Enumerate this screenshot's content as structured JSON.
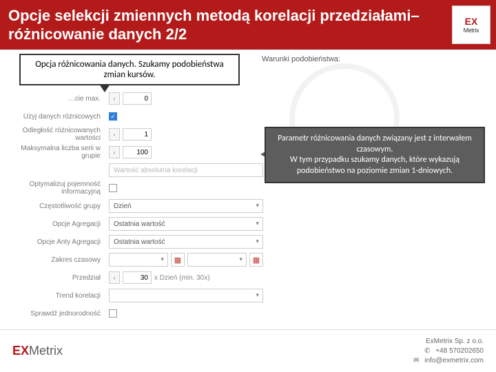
{
  "header": {
    "title": "Opcje selekcji zmiennych metodą korelacji przedziałami– różnicowanie danych 2/2"
  },
  "logo": {
    "ex": "EX",
    "metrix": "Metrix"
  },
  "leadLabel": "Warunki podobieństwa:",
  "callout1": "Opcja różnicowania danych. Szukamy podobieństwa zmian kursów.",
  "callout2": "Parametr różnicowania danych związany jest z interwałem czasowym.\nW tym przypadku szukamy danych, które wykazują podobieństwo na poziomie zmian 1-dniowych.",
  "form": {
    "rows": [
      {
        "label": "…cie max.",
        "stepperValue": "0"
      },
      {
        "label": "Użyj danych różnicowych",
        "check": true
      },
      {
        "label": "Odległość różnicowanych wartości",
        "stepperValue": "1"
      },
      {
        "label": "Maksymalna liczba serii w grupie",
        "stepperValue": "100"
      },
      {
        "label": "",
        "placeholder": "Wartość absolutna korelacji"
      },
      {
        "label": "Optymalizuj pojemność informacyjną",
        "check": false
      },
      {
        "label": "Częstotliwość grupy",
        "select": "Dzień"
      },
      {
        "label": "Opcje Agregacji",
        "select": "Ostatnia wartość"
      },
      {
        "label": "Opcje Anty Agregacji",
        "select": "Ostatnia wartość"
      },
      {
        "label": "Zakres czasowy",
        "date": true
      },
      {
        "label": "Przedział",
        "stepperValue": "30",
        "hint": "x Dzień (min. 30x)"
      },
      {
        "label": "Trend korelacji",
        "select": ""
      },
      {
        "label": "Sprawdź jednorodność",
        "check": false
      }
    ]
  },
  "footer": {
    "brandEx": "EX",
    "brandMetrix": "Metrix",
    "company": "ExMetrix Sp. z o.o.",
    "phone": "+48 570202650",
    "site": "info@exmetrix.com"
  }
}
